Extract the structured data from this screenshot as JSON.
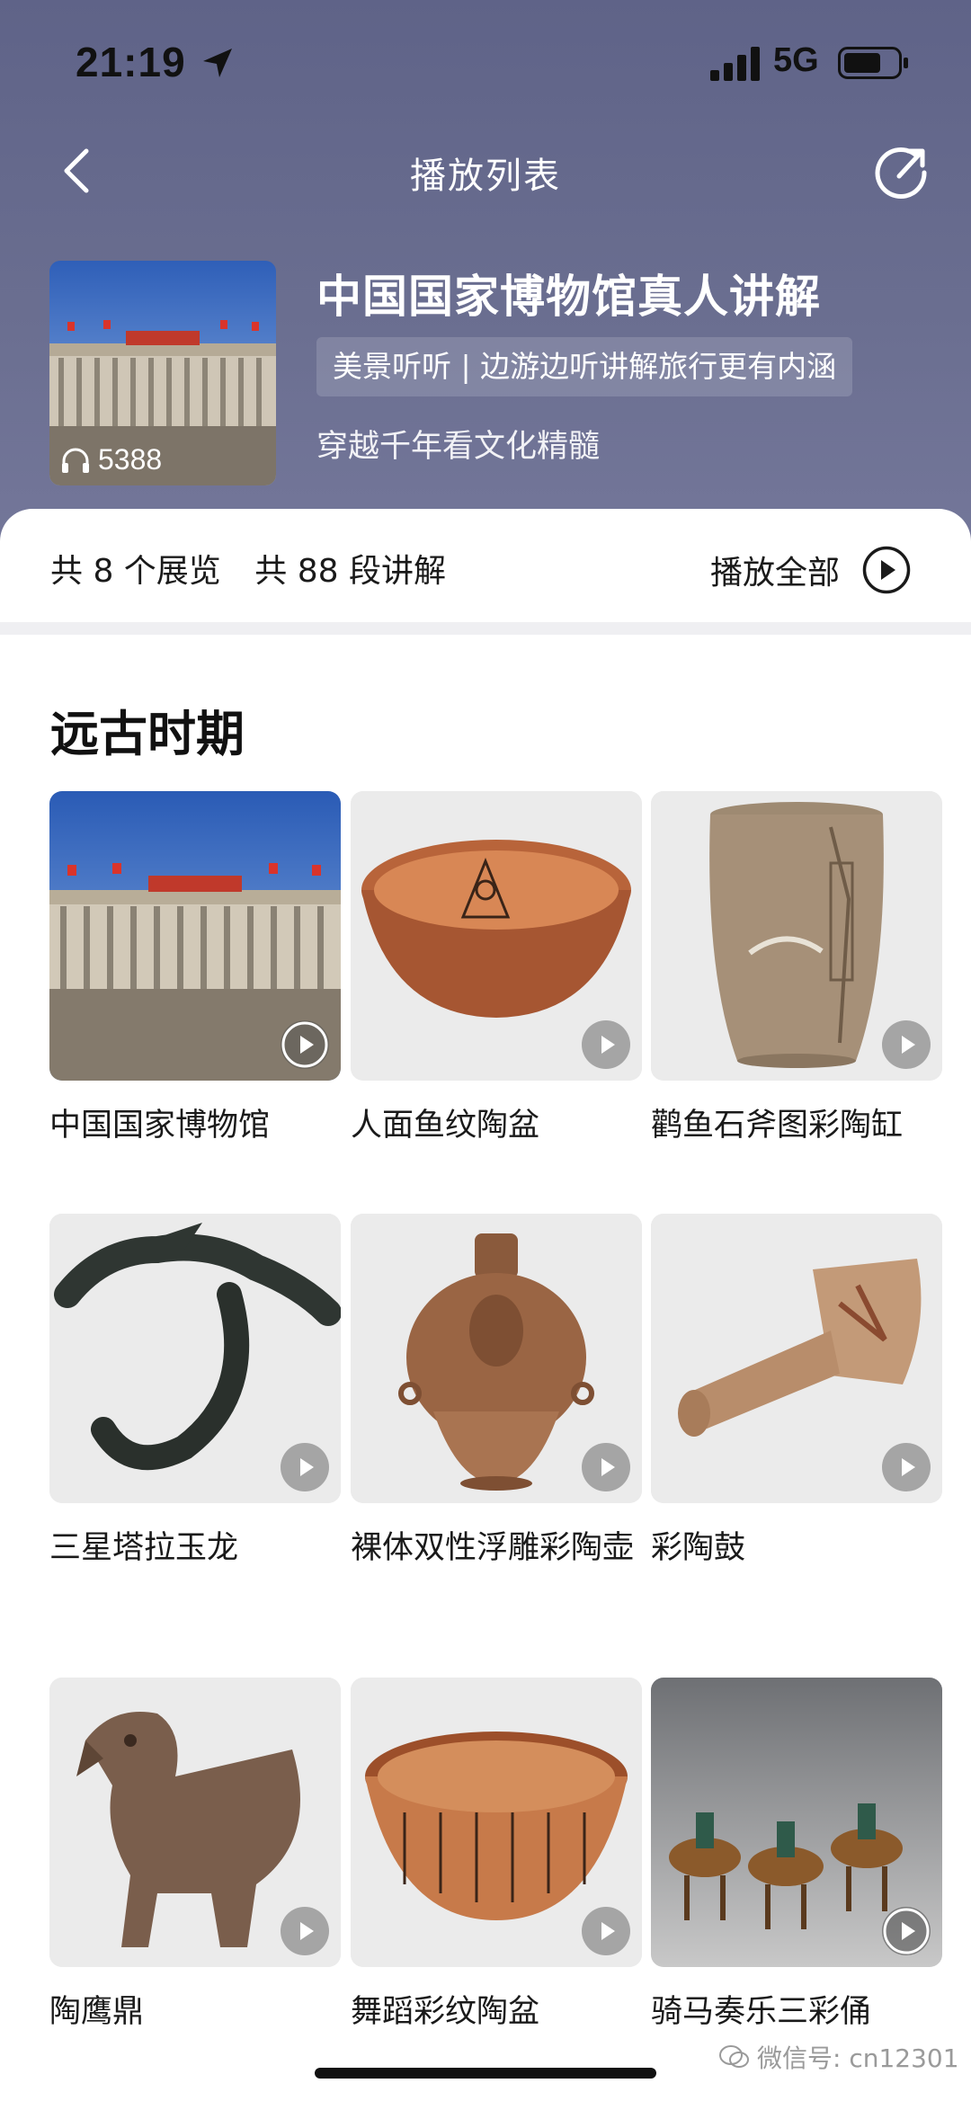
{
  "status_bar": {
    "time": "21:19",
    "network": "5G"
  },
  "nav": {
    "title": "播放列表"
  },
  "hero": {
    "title": "中国国家博物馆真人讲解",
    "tag": "美景听听 | 边游边听讲解旅行更有内涵",
    "subtitle": "穿越千年看文化精髓",
    "listen_count": "5388"
  },
  "summary": {
    "exhibitions": "共 8 个展览",
    "segments": "共 88 段讲解",
    "play_all": "播放全部"
  },
  "section": {
    "title": "远古时期",
    "items": [
      {
        "title": "中国国家博物馆"
      },
      {
        "title": "人面鱼纹陶盆"
      },
      {
        "title": "鹳鱼石斧图彩陶缸"
      },
      {
        "title": "三星塔拉玉龙"
      },
      {
        "title": "裸体双性浮雕彩陶壶"
      },
      {
        "title": "彩陶鼓"
      },
      {
        "title": "陶鹰鼎"
      },
      {
        "title": "舞蹈彩纹陶盆"
      },
      {
        "title": "骑马奏乐三彩俑"
      }
    ]
  },
  "watermark": "微信号: cn12301",
  "colors": {
    "header": "#62668a",
    "accent": "#1a1a1a"
  }
}
